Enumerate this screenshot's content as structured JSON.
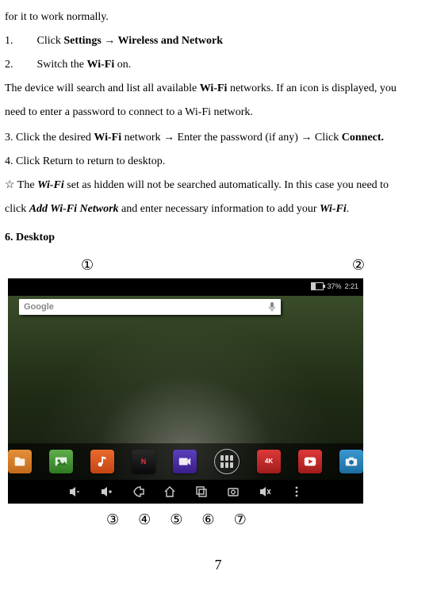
{
  "intro": "for it to work normally.",
  "step1": {
    "num": "1.",
    "lead": "Click ",
    "bold": "Settings → Wireless and Network"
  },
  "step2": {
    "num": "2.",
    "lead": "Switch the ",
    "bold": "Wi-Fi",
    "tail": " on."
  },
  "para_search_1": "The device will search and list all available ",
  "para_search_bold": "Wi-Fi",
  "para_search_2": " networks. If an icon is displayed, you",
  "para_search_3": "need to enter a password to connect to a Wi-Fi network.",
  "step3": {
    "lead": "3. Click the desired ",
    "b1": "Wi-Fi",
    "mid1": " network  ",
    "arrow": "→",
    "mid2": "  Enter the password (if any)  ",
    "mid3": "  Click ",
    "b2": "Connect."
  },
  "step4": "4. Click Return to return to desktop.",
  "note": {
    "star": "☆",
    "t1": "  The ",
    "bi1": "Wi-Fi",
    "t2": " set as hidden will not be searched automatically. In this case you need to",
    "t3": "click ",
    "bi2": "Add Wi-Fi Network",
    "t4": " and enter necessary information to add your ",
    "bi3": "Wi-Fi",
    "t5": "."
  },
  "section6": "6. Desktop",
  "circled": {
    "c1": "①",
    "c2": "②",
    "c3": "③",
    "c4": "④",
    "c5": "⑤",
    "c6": "⑥",
    "c7": "⑦"
  },
  "screenshot": {
    "status": {
      "battery_pct": "37%",
      "time": "2:21"
    },
    "search": {
      "logo": "Google"
    },
    "dock": {
      "netflix": "N",
      "fourk": "4K"
    }
  },
  "page_number": "7"
}
